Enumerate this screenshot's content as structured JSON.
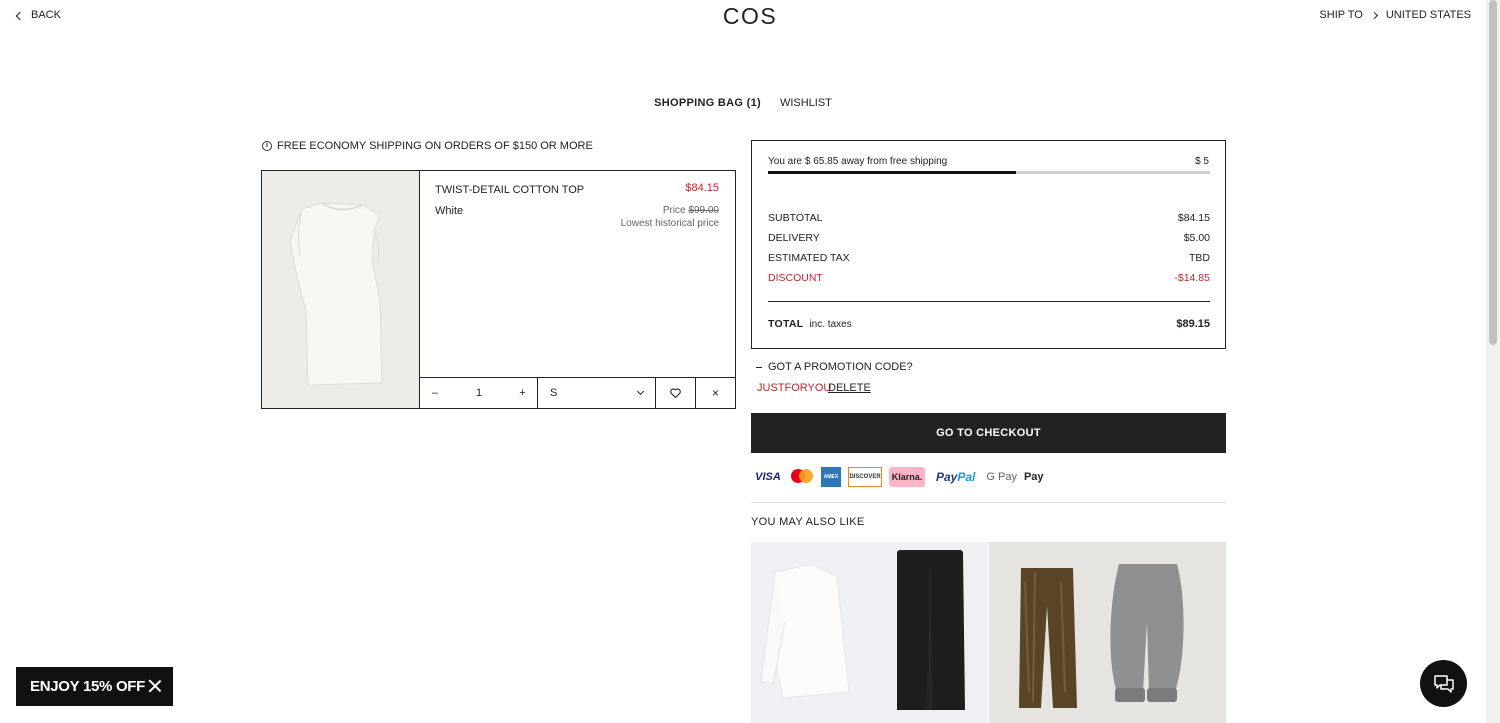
{
  "header": {
    "back_label": "BACK",
    "logo": "COS",
    "ship_to_label": "SHIP TO",
    "ship_to_country": "UNITED STATES"
  },
  "tabs": {
    "bag": "SHOPPING BAG (1)",
    "wishlist": "WISHLIST"
  },
  "shipping_note": "FREE ECONOMY SHIPPING ON ORDERS OF $150 OR MORE",
  "cart_item": {
    "name": "TWIST-DETAIL COTTON TOP",
    "color": "White",
    "price": "$84.15",
    "orig_label": "Price",
    "orig_price": "$99.00",
    "lowest_label": "Lowest historical price",
    "quantity": "1",
    "size": "S",
    "minus": "–",
    "plus": "+",
    "remove": "×"
  },
  "summary": {
    "progress_text": "You are $ 65.85 away from free shipping",
    "progress_amount": "$ 5",
    "progress_fraction": 0.56,
    "subtotal_label": "SUBTOTAL",
    "subtotal": "$84.15",
    "delivery_label": "DELIVERY",
    "delivery": "$5.00",
    "tax_label": "ESTIMATED TAX",
    "tax": "TBD",
    "discount_label": "DISCOUNT",
    "discount": "-$14.85",
    "total_label": "TOTAL",
    "total_note": "inc. taxes",
    "total": "$89.15"
  },
  "promo": {
    "toggle_label": "GOT A PROMOTION CODE?",
    "code": "JUSTFORYOU",
    "delete_label": "DELETE"
  },
  "checkout_label": "GO TO CHECKOUT",
  "payments": {
    "visa": "VISA",
    "amex": "AMEX",
    "discover": "DISCOVER",
    "klarna": "Klarna.",
    "paypal_a": "Pay",
    "paypal_b": "Pal",
    "gpay": "G Pay",
    "applepay": " Pay"
  },
  "recommendations_title": "YOU MAY ALSO LIKE",
  "promo_banner": "ENJOY 15% OFF",
  "colors": {
    "accent_red": "#c0272d",
    "dark": "#222222"
  }
}
